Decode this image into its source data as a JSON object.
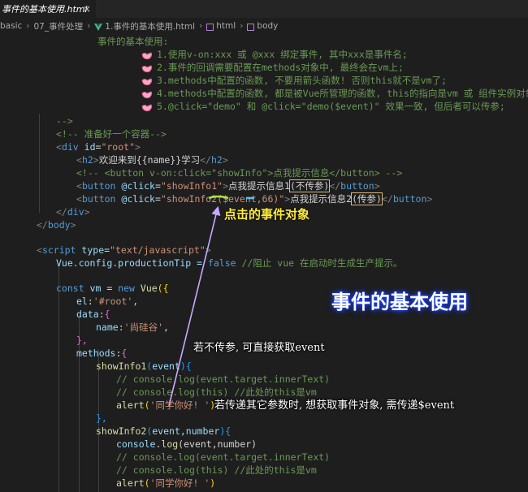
{
  "tab": {
    "title": "事件的基本使用.html",
    "close_icon": "×"
  },
  "breadcrumb": [
    "basic",
    "07_事件处理",
    "1.事件的基本使用.html",
    "html",
    "body"
  ],
  "code": {
    "notes_title": "事件的基本使用:",
    "notes": [
      "1.使用v-on:xxx 或 @xxx 绑定事件, 其中xxx是事件名;",
      "2.事件的回调需要配置在methods对象中, 最终会在vm上;",
      "3.methods中配置的函数, 不要用箭头函数! 否则this就不是vm了;",
      "4.methods中配置的函数, 都是被Vue所管理的函数, this的指向是vm 或 组件实例对象;",
      "5.@click=\"demo\" 和 @click=\"demo($event)\" 效果一致, 但后者可以传参;"
    ],
    "comment_end": "-->",
    "container_comment": "<!-- 准备好一个容器-->",
    "div_open": {
      "tag": "div",
      "attr": "id",
      "value": "\"root\""
    },
    "h2": {
      "tag": "h2",
      "text": "欢迎来到{{name}}学习"
    },
    "button_comment": "<!-- <button v-on:click=\"showInfo\">点我提示信息</button> -->",
    "button1": {
      "attr": "@click",
      "value": "\"showInfo1\"",
      "text_before": "点我提示信息1",
      "hl_text": "(不传参)"
    },
    "button2": {
      "attr": "@click",
      "value_open": "\"showInfo2(",
      "event_arg": "$event",
      "value_rest": ",66)\"",
      "text_before": "点我提示信息2",
      "hl_text": "(传参)"
    },
    "div_close": "div",
    "body_close": "body",
    "script_open": {
      "tag": "script",
      "attr": "type",
      "value": "\"text/javascript\""
    },
    "config_line": {
      "object": "Vue",
      "rest": ".config.productionTip = ",
      "value": "false",
      "comment": " //阻止 vue 在启动时生成生产提示。"
    },
    "const_line": {
      "kw": "const",
      "name": " vm ",
      "op": "= ",
      "new": "new",
      "cls": " Vue",
      "brace": "({"
    },
    "el_line": {
      "key": "el",
      "value": "'#root'"
    },
    "data_line": {
      "key": "data",
      "brace": "{"
    },
    "name_line": {
      "key": "name",
      "value": "'尚硅谷'"
    },
    "close_brace_comma": "},",
    "methods_line": {
      "key": "methods",
      "brace": "{"
    },
    "show1_line": {
      "fn": "showInfo1",
      "param": "event",
      "brace": "{"
    },
    "show1_cmt1": "// console.log(event.target.innerText)",
    "show1_cmt2": "// console.log(this) //此处的this是vm",
    "alert1": {
      "fn": "alert",
      "arg": "'同学你好! '"
    },
    "show2_line": {
      "fn": "showInfo2",
      "params": "event,number",
      "brace": "{"
    },
    "log_line": {
      "obj": "console",
      "fn": ".log",
      "args": "(event,number)"
    },
    "show2_cmt1": "// console.log(event.target.innerText)",
    "show2_cmt2": "// console.log(this) //此处的this是vm",
    "alert2": {
      "fn": "alert",
      "arg": "'同学你好! '"
    },
    "close_brace": "}"
  },
  "annotations": {
    "event_object": "点击的事件对象",
    "title": "事件的基本使用",
    "no_param": "若不传参, 可直接获取event",
    "with_param": "若传递其它参数时, 想获取事件对象, 需传递$event"
  },
  "colors": {
    "editor_bg": "#1e1e1e",
    "annotation_yellow": "#ffeb3b",
    "title_glow": "#1e46ff",
    "arrow": "#c8a8ff"
  }
}
